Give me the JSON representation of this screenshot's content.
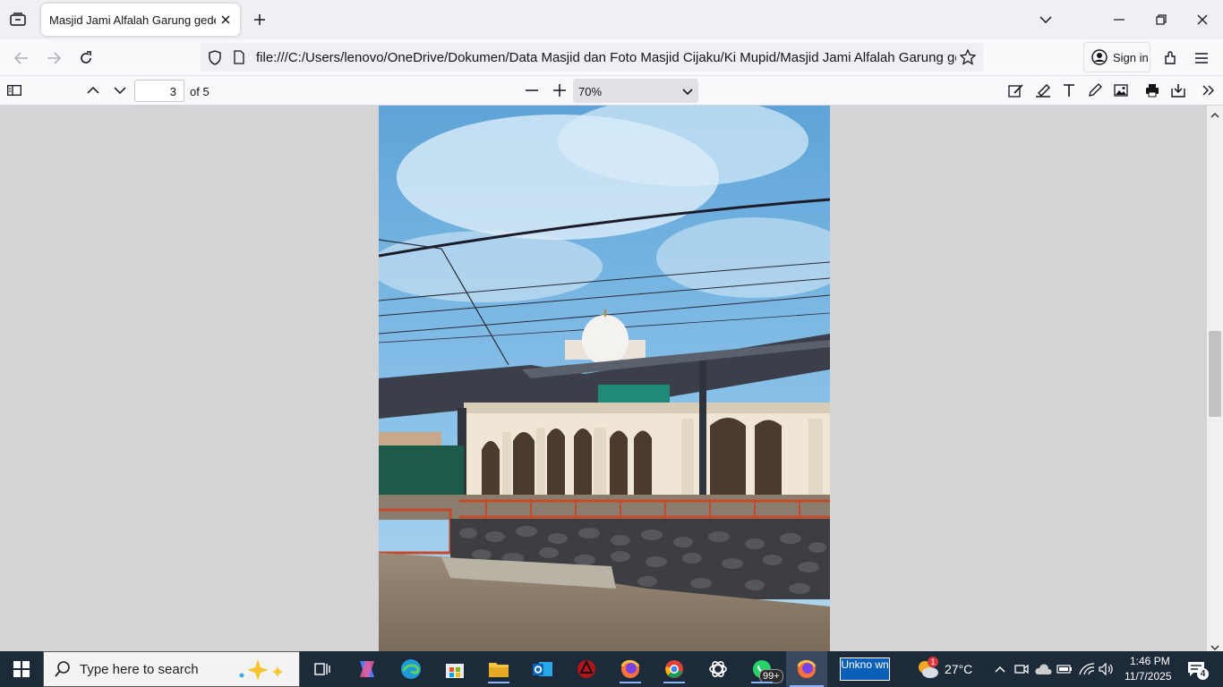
{
  "browser": {
    "tab_title": "Masjid Jami Alfalah Garung gede cihuni.pdf",
    "url": "file:///C:/Users/lenovo/OneDrive/Dokumen/Data Masjid dan Foto Masjid Cijaku/Ki Mupid/Masjid Jami Alfalah Garung gede cihuni.pdf",
    "sign_in_label": "Sign in"
  },
  "pdf_toolbar": {
    "page_number": "3",
    "page_of": "of 5",
    "zoom": "70%"
  },
  "taskbar": {
    "search_placeholder": "Type here to search",
    "whatsapp_badge": "99+",
    "unknown_label": "Unkno wn",
    "weather_badge": "1",
    "temperature": "27°C",
    "time": "1:46 PM",
    "date": "11/7/2025",
    "notifications_count": "4"
  }
}
